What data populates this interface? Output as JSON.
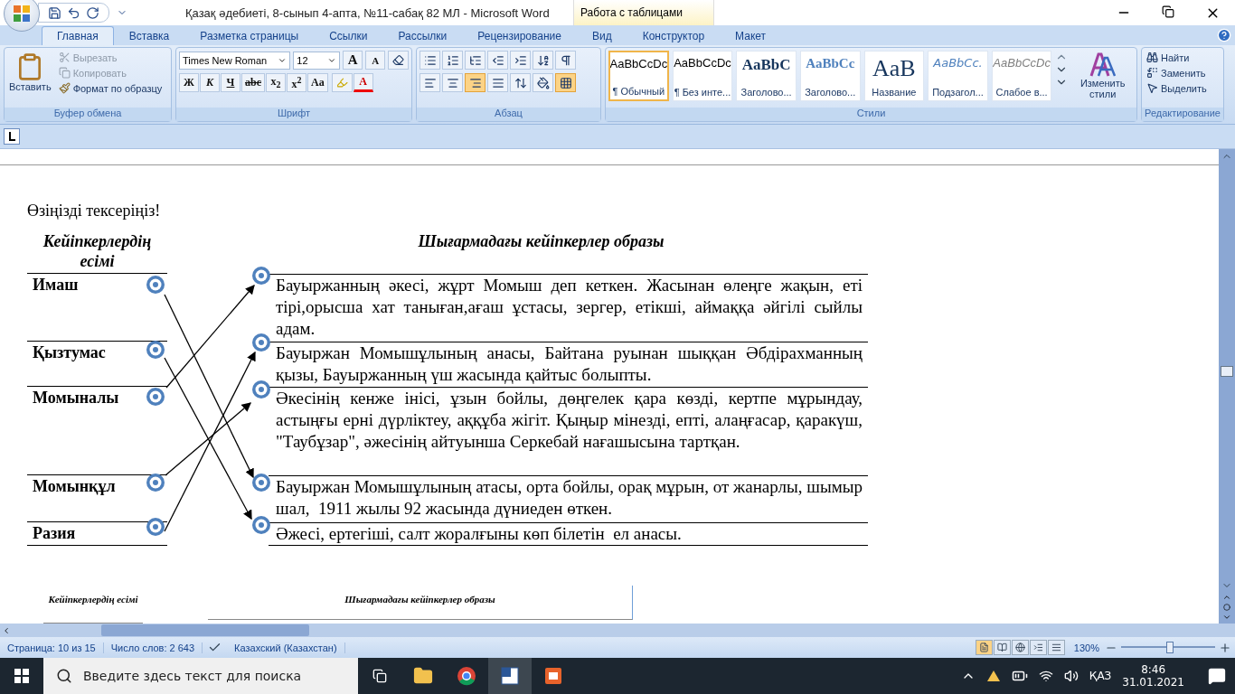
{
  "window": {
    "title": "Қазақ әдебиеті, 8-сынып 4-апта, №11-сабақ  82 МЛ  -  Microsoft Word",
    "context_tab": "Работа с таблицами"
  },
  "tabs": [
    {
      "label": "Главная",
      "selected": true
    },
    {
      "label": "Вставка",
      "selected": false
    },
    {
      "label": "Разметка страницы",
      "selected": false
    },
    {
      "label": "Ссылки",
      "selected": false
    },
    {
      "label": "Рассылки",
      "selected": false
    },
    {
      "label": "Рецензирование",
      "selected": false
    },
    {
      "label": "Вид",
      "selected": false
    },
    {
      "label": "Конструктор",
      "selected": false
    },
    {
      "label": "Макет",
      "selected": false
    }
  ],
  "clipboard": {
    "paste": "Вставить",
    "items": [
      {
        "kind": "cut",
        "label": "Вырезать",
        "disabled": true
      },
      {
        "kind": "copy",
        "label": "Копировать",
        "disabled": true
      },
      {
        "kind": "format",
        "label": "Формат по образцу",
        "disabled": false
      }
    ],
    "label": "Буфер обмена"
  },
  "font": {
    "name": "Times New Roman",
    "size": "12",
    "grow": "A",
    "shrink": "A",
    "format_buttons": [
      "Ж",
      "К",
      "Ч",
      "abc",
      "x$_{2}$",
      "x$^{2}$",
      "Aa"
    ],
    "color_letter": "A",
    "label": "Шрифт"
  },
  "paragraph": {
    "row1": [
      {
        "kind": "bullets",
        "selected": false
      },
      {
        "kind": "numbering",
        "selected": false
      },
      {
        "kind": "multilevel",
        "selected": false
      },
      {
        "kind": "outdent",
        "selected": false
      },
      {
        "kind": "indent",
        "selected": false
      },
      {
        "kind": "sort",
        "selected": false
      },
      {
        "kind": "pilcrow",
        "selected": false
      }
    ],
    "row2": [
      {
        "kind": "left",
        "selected": false
      },
      {
        "kind": "center",
        "selected": false
      },
      {
        "kind": "right",
        "selected": true
      },
      {
        "kind": "justify",
        "selected": false
      },
      {
        "kind": "spacing",
        "selected": false
      },
      {
        "kind": "shading",
        "selected": false
      },
      {
        "kind": "borders",
        "selected": true
      }
    ],
    "label": "Абзац"
  },
  "styles": {
    "items": [
      {
        "preview": "AaBbCcDc",
        "name": "¶ Обычный",
        "kind": "normal",
        "selected": true
      },
      {
        "preview": "AaBbCcDc",
        "name": "¶ Без инте...",
        "kind": "normal",
        "selected": false
      },
      {
        "preview": "AaBbC",
        "name": "Заголово...",
        "kind": "heading1",
        "selected": false
      },
      {
        "preview": "AaBbCc",
        "name": "Заголово...",
        "kind": "heading2",
        "selected": false
      },
      {
        "preview": "AaB",
        "name": "Название",
        "kind": "title",
        "selected": false
      },
      {
        "preview": "AaBbCc.",
        "name": "Подзагол...",
        "kind": "subtitle",
        "selected": false
      },
      {
        "preview": "AaBbCcDc",
        "name": "Слабое в...",
        "kind": "emphasis",
        "selected": false
      }
    ],
    "change": "Изменить стили",
    "label": "Стили"
  },
  "editing": {
    "items": [
      {
        "kind": "find",
        "label": "Найти"
      },
      {
        "kind": "replace",
        "label": "Заменить"
      },
      {
        "kind": "select",
        "label": "Выделить"
      }
    ],
    "label": "Редактирование"
  },
  "document": {
    "prompt": "Өзіңізді тексеріңіз!",
    "header_left": "Кейіпкерлердің есімі",
    "header_right": "Шығармадағы кейіпкерлер образы",
    "names": [
      "Имаш",
      "Қызтумас",
      "Момыналы",
      "Момынқұл",
      "Разия"
    ],
    "descriptions": [
      "Бауыржанның әкесі, жұрт Момыш деп кеткен. Жасынан өлеңге жақын, еті тірі,орысша хат таныған,ағаш ұстасы, зергер, етікші, аймаққа әйгілі сыйлы адам.",
      "Бауыржан Момышұлының анасы, Байтана руынан шыққан Әбдірахманның қызы, Бауыржанның үш жасында қайтыс болыпты.",
      "Әкесінің кенже інісі, ұзын бойлы, дөңгелек қара көзді, кертпе мұрындау, астыңғы ерні дүрліктеу, аққұба жігіт. Қыңыр мінезді, епті, алаңғасар, қаракүш, \"Таубұзар\", әжесінің айтуынша Серкебай нағашысына тартқан.",
      "Бауыржан Момышұлының атасы, орта бойлы, орақ мұрын, от жанарлы, шымыр шал,  1911 жылы 92 жасында дүниеден өткен.",
      "Әжесі, ертегіші, салт жоралғыны көп білетін  ел анасы."
    ],
    "next_header_left": "Кейіпкерлердің есімі",
    "next_header_right": "Шығармадағы кейіпкерлер образы"
  },
  "status_bar": {
    "page": "Страница: 10 из 15",
    "words": "Число слов: 2 643",
    "language": "Казахский (Казахстан)",
    "views": [
      {
        "selected": true
      },
      {
        "selected": false
      },
      {
        "selected": false
      },
      {
        "selected": false
      },
      {
        "selected": false
      }
    ],
    "zoom": "130%",
    "zoom_slider": {
      "level": 0.52
    }
  },
  "taskbar": {
    "search": {
      "placeholder": "Введите здесь текст для поиска"
    },
    "language": "ҚАЗ",
    "time": "8:46",
    "date": "31.01.2021"
  }
}
